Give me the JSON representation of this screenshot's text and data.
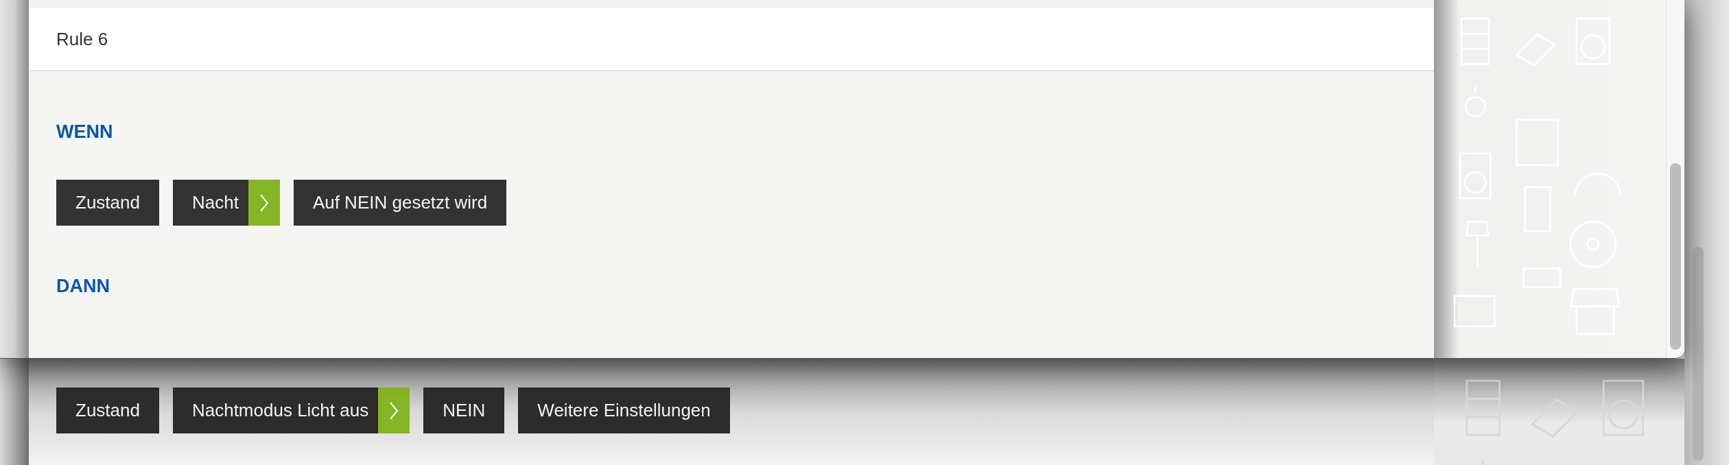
{
  "rule": {
    "title": "Rule 6"
  },
  "sections": [
    {
      "heading": "WENN",
      "chips": [
        {
          "label": "Zustand",
          "kind": "plain"
        },
        {
          "label": "Nacht",
          "kind": "expandable"
        },
        {
          "label": "Auf NEIN gesetzt wird",
          "kind": "plain"
        }
      ]
    },
    {
      "heading": "DANN",
      "chips": [
        {
          "label": "Zustand",
          "kind": "plain"
        },
        {
          "label": "Nachtmodus Licht aus",
          "kind": "expandable"
        },
        {
          "label": "NEIN",
          "kind": "plain"
        },
        {
          "label": "Weitere Einstellungen",
          "kind": "plain"
        }
      ]
    }
  ]
}
